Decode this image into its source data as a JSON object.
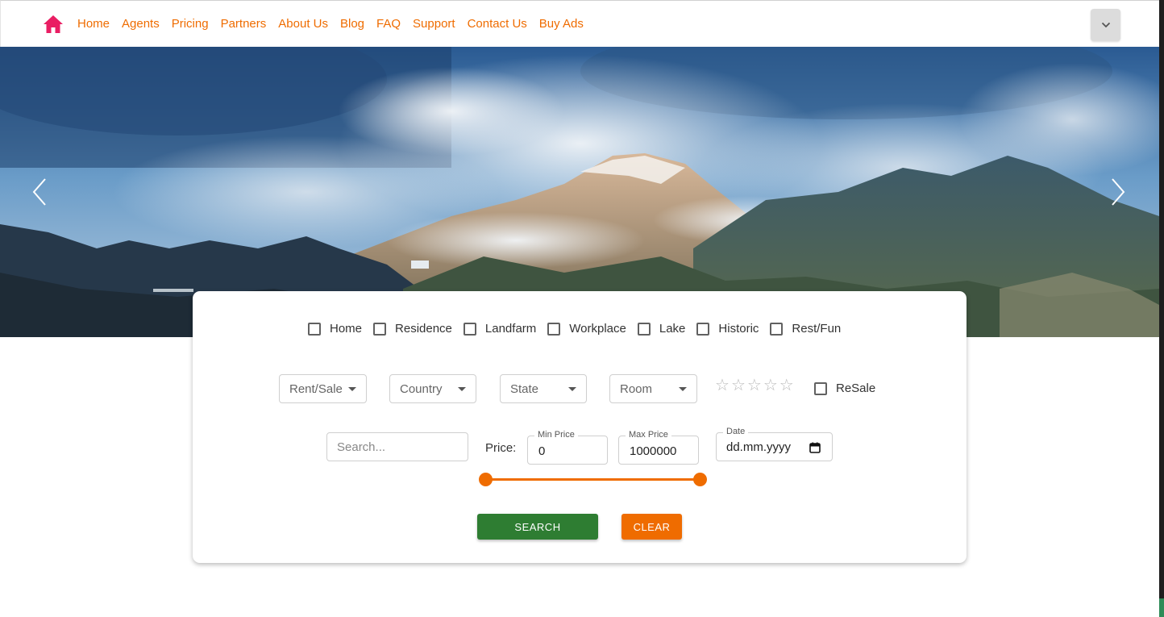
{
  "nav": {
    "links": [
      "Home",
      "Agents",
      "Pricing",
      "Partners",
      "About Us",
      "Blog",
      "FAQ",
      "Support",
      "Contact Us",
      "Buy Ads"
    ],
    "link_color": "#ef6c00",
    "logo_color": "#e91e63",
    "logo_icon": "home-icon",
    "menu_icon": "chevron-down-icon"
  },
  "hero": {
    "prev_icon": "chevron-left-icon",
    "next_icon": "chevron-right-icon"
  },
  "search_card": {
    "property_types": [
      "Home",
      "Residence",
      "Landfarm",
      "Workplace",
      "Lake",
      "Historic",
      "Rest/Fun"
    ],
    "dropdowns": {
      "rent_sale": "Rent/Sale",
      "country": "Country",
      "state": "State",
      "room": "Room"
    },
    "rating": {
      "max": 5,
      "value": 0
    },
    "resale_label": "ReSale",
    "search_placeholder": "Search...",
    "price_label": "Price:",
    "min_price_label": "Min Price",
    "min_price_value": "0",
    "max_price_label": "Max Price",
    "max_price_value": "1000000",
    "date_label": "Date",
    "date_placeholder": "dd.mm.yyyy",
    "price_range": {
      "min": 0,
      "max": 1000000,
      "low": 0,
      "high": 1000000
    },
    "search_button": "SEARCH",
    "clear_button": "CLEAR",
    "search_color": "#2e7d32",
    "accent_color": "#ef6c00"
  }
}
